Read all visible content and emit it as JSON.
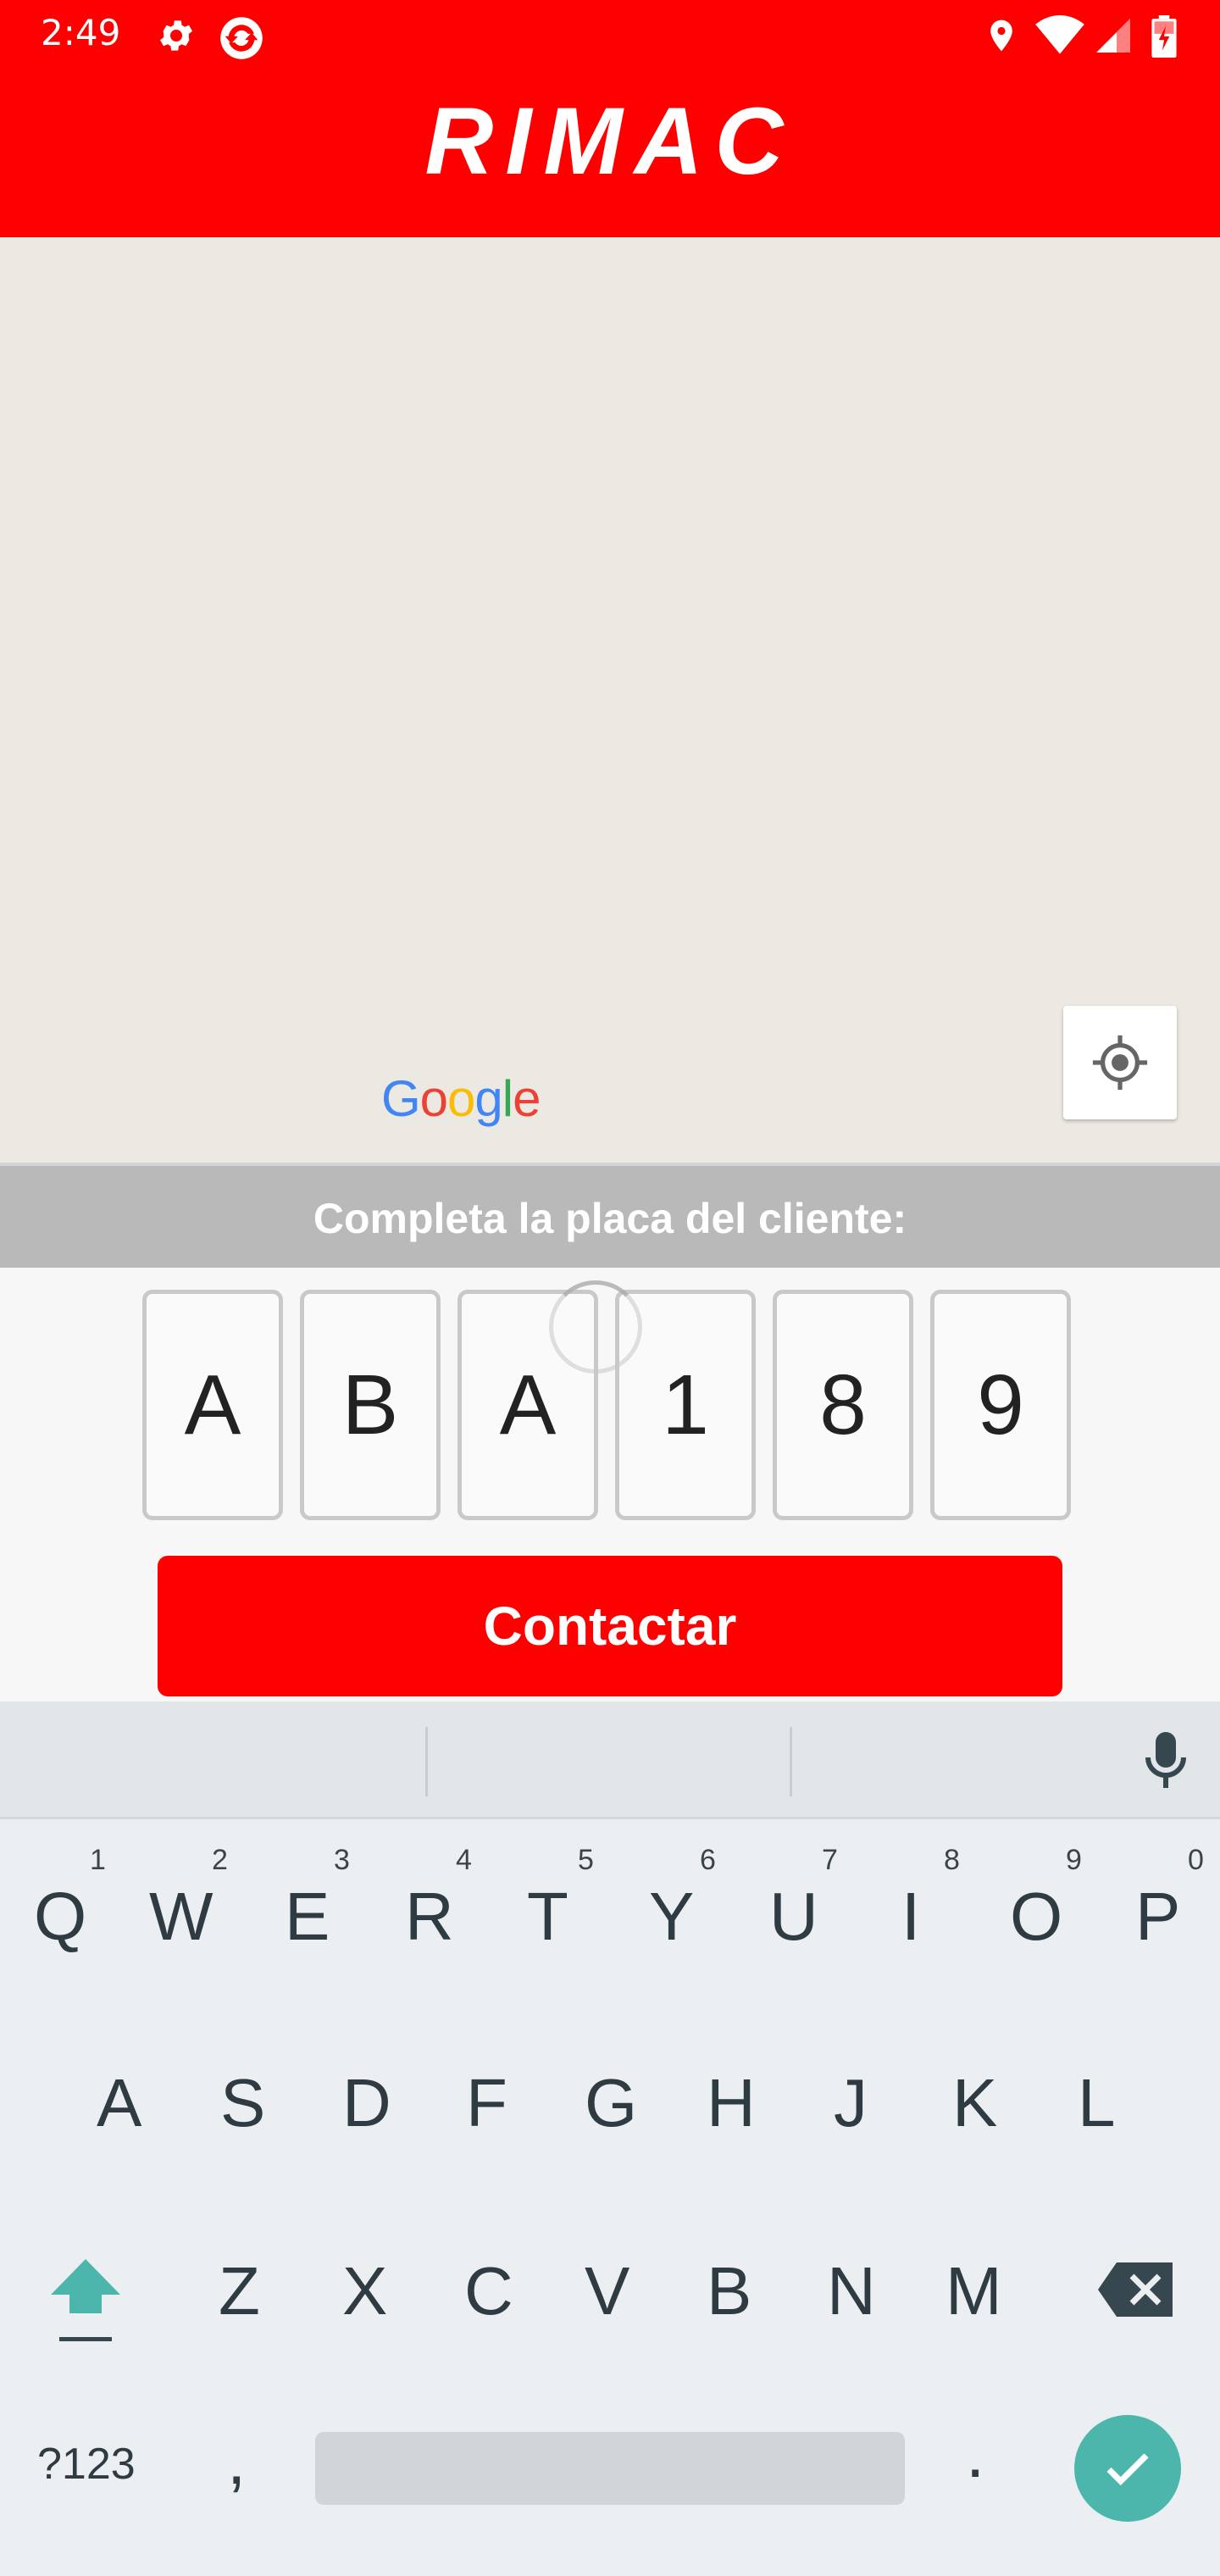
{
  "status": {
    "time": "2:49"
  },
  "header": {
    "brand": "RIMAC"
  },
  "map": {
    "attribution": [
      "G",
      "o",
      "o",
      "g",
      "l",
      "e"
    ],
    "attribution_colors": [
      "#4285F4",
      "#EA4335",
      "#FBBC05",
      "#4285F4",
      "#34A853",
      "#EA4335"
    ]
  },
  "panel": {
    "title": "Completa la placa del cliente:",
    "plate": [
      "A",
      "B",
      "A",
      "1",
      "8",
      "9"
    ],
    "contact_label": "Contactar"
  },
  "keyboard": {
    "row1": [
      {
        "key": "Q",
        "hint": "1"
      },
      {
        "key": "W",
        "hint": "2"
      },
      {
        "key": "E",
        "hint": "3"
      },
      {
        "key": "R",
        "hint": "4"
      },
      {
        "key": "T",
        "hint": "5"
      },
      {
        "key": "Y",
        "hint": "6"
      },
      {
        "key": "U",
        "hint": "7"
      },
      {
        "key": "I",
        "hint": "8"
      },
      {
        "key": "O",
        "hint": "9"
      },
      {
        "key": "P",
        "hint": "0"
      }
    ],
    "row2": [
      "A",
      "S",
      "D",
      "F",
      "G",
      "H",
      "J",
      "K",
      "L"
    ],
    "row3": [
      "Z",
      "X",
      "C",
      "V",
      "B",
      "N",
      "M"
    ],
    "symbols_label": "?123",
    "comma": ",",
    "period": "."
  },
  "colors": {
    "brand_red": "#FF0000",
    "enter_teal": "#4DB6AC"
  }
}
